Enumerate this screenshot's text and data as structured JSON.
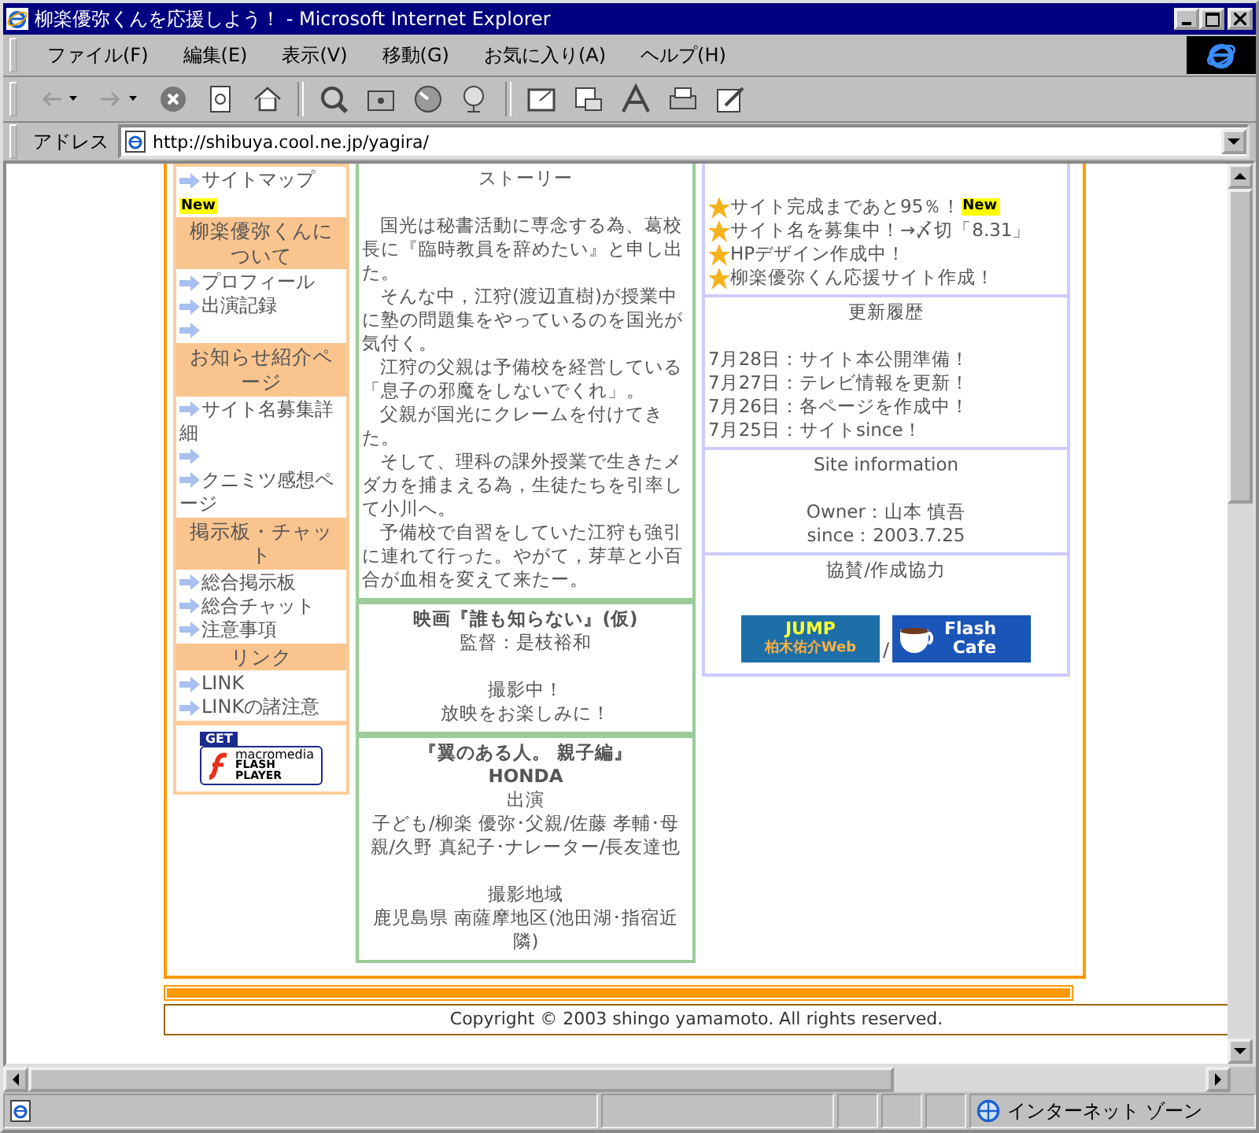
{
  "window": {
    "title": "柳楽優弥くんを応援しよう！ - Microsoft Internet Explorer"
  },
  "menu": [
    "ファイル(F)",
    "編集(E)",
    "表示(V)",
    "移動(G)",
    "お気に入り(A)",
    "ヘルプ(H)"
  ],
  "toolbar": [
    {
      "kind": "back",
      "disabled": true
    },
    {
      "kind": "forward",
      "disabled": true
    },
    {
      "kind": "stop"
    },
    {
      "kind": "refresh"
    },
    {
      "kind": "home"
    },
    {
      "kind": "sep"
    },
    {
      "kind": "search"
    },
    {
      "kind": "favorites"
    },
    {
      "kind": "history"
    },
    {
      "kind": "channels"
    },
    {
      "kind": "sep"
    },
    {
      "kind": "fullscreen"
    },
    {
      "kind": "mail"
    },
    {
      "kind": "font"
    },
    {
      "kind": "print"
    },
    {
      "kind": "edit"
    }
  ],
  "address": {
    "label": "アドレス",
    "value": "http://shibuya.cool.ne.jp/yagira/"
  },
  "sidebar": [
    {
      "links": [
        {
          "kind": "link",
          "text": "サイトマップ",
          "badge": "New"
        }
      ]
    },
    {
      "heading": "柳楽優弥くんについて",
      "links": [
        {
          "kind": "link",
          "text": "プロフィール"
        },
        {
          "kind": "link",
          "text": "出演記録"
        },
        {
          "kind": "blank"
        }
      ]
    },
    {
      "heading": "お知らせ紹介ページ",
      "links": [
        {
          "kind": "link",
          "text": "サイト名募集詳細"
        },
        {
          "kind": "blank"
        },
        {
          "kind": "link",
          "text": "クニミツ感想ページ"
        }
      ]
    },
    {
      "heading": "掲示板・チャット",
      "links": [
        {
          "kind": "link",
          "text": "総合掲示板"
        },
        {
          "kind": "link",
          "text": "総合チャット"
        },
        {
          "kind": "link",
          "text": "注意事項"
        }
      ]
    },
    {
      "heading": "リンク",
      "links": [
        {
          "kind": "link",
          "text": "LINK"
        },
        {
          "kind": "link",
          "text": "LINKの諸注意"
        }
      ]
    }
  ],
  "flash_badge": {
    "get": "GET",
    "brand": "macromedia",
    "product": "FLASH",
    "player": "PLAYER"
  },
  "middle": [
    {
      "lines": [
        {
          "kind": "center",
          "text": "ストーリー"
        },
        {
          "kind": "gap"
        },
        {
          "kind": "para",
          "text": "国光は秘書活動に専念する為、葛校長に『臨時教員を辞めたい』と申し出た。"
        },
        {
          "kind": "para",
          "text": "そんな中，江狩(渡辺直樹)が授業中に塾の問題集をやっているのを国光が気付く。"
        },
        {
          "kind": "para",
          "text": "江狩の父親は予備校を経営している「息子の邪魔をしないでくれ」。"
        },
        {
          "kind": "para",
          "text": "父親が国光にクレームを付けてきた。"
        },
        {
          "kind": "para",
          "text": "そして、理科の課外授業で生きたメダカを捕まえる為，生徒たちを引率して小川へ。"
        },
        {
          "kind": "para",
          "text": "予備校で自習をしていた江狩も強引に連れて行った。やがて，芽草と小百合が血相を変えて来たー。"
        }
      ]
    },
    {
      "lines": [
        {
          "kind": "bold",
          "text": "映画『誰も知らない』(仮)"
        },
        {
          "kind": "center",
          "text": "監督：是枝裕和"
        },
        {
          "kind": "gap"
        },
        {
          "kind": "center",
          "text": "撮影中！"
        },
        {
          "kind": "center",
          "text": "放映をお楽しみに！"
        }
      ]
    },
    {
      "lines": [
        {
          "kind": "bold",
          "text": "『翼のある人。 親子編』"
        },
        {
          "kind": "bold",
          "text": "HONDA"
        },
        {
          "kind": "center",
          "text": "出演"
        },
        {
          "kind": "center",
          "text": "子ども/柳楽 優弥･父親/佐藤 孝輔･母親/久野 真紀子･ナレーター/長友達也"
        },
        {
          "kind": "gap"
        },
        {
          "kind": "center",
          "text": "撮影地域"
        },
        {
          "kind": "center",
          "text": "鹿児島県 南薩摩地区(池田湖･指宿近隣)"
        }
      ]
    }
  ],
  "news": [
    {
      "text": "サイト完成まであと95％！",
      "badge": "New"
    },
    {
      "text": "サイト名を募集中！→〆切「8.31」"
    },
    {
      "text": "HPデザイン作成中！"
    },
    {
      "text": "柳楽優弥くん応援サイト作成！"
    }
  ],
  "history": {
    "heading": "更新履歴",
    "items": [
      "7月28日：サイト本公開準備！",
      "7月27日：テレビ情報を更新！",
      "7月26日：各ページを作成中！",
      "7月25日：サイトsince！"
    ]
  },
  "site_info": {
    "heading": "Site information",
    "owner": "Owner：山本 慎吾",
    "since": "since：2003.7.25"
  },
  "sponsors": {
    "heading": "協賛/作成協力",
    "banners": [
      {
        "kind": "jump",
        "title": "JUMP",
        "subtitle": "柏木佑介Web"
      },
      {
        "kind": "flash",
        "title": "Flash",
        "subtitle": "Cafe"
      }
    ],
    "separator": "/"
  },
  "copyright": "Copyright © 2003 shingo yamamoto. All rights reserved.",
  "status": {
    "zone": "インターネット ゾーン"
  }
}
